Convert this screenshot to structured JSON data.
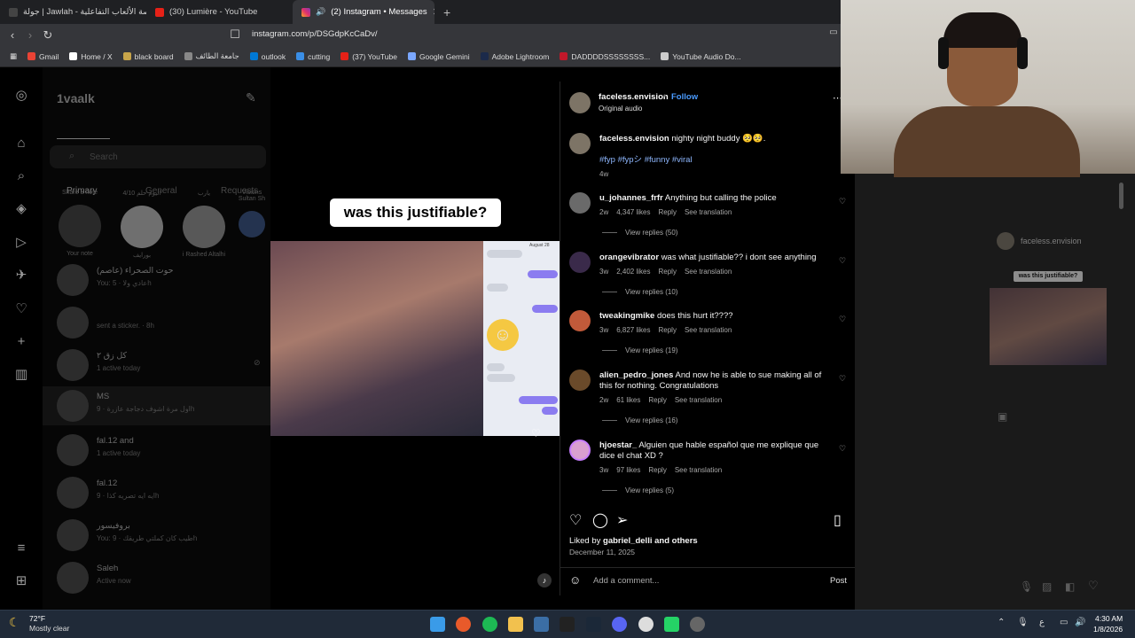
{
  "browser": {
    "tabs": [
      {
        "label": "جولة | Jawlah - منصة الألعاب التفاعلية",
        "active": false
      },
      {
        "label": "(30) Lumière - YouTube",
        "active": false
      },
      {
        "label": "(2) Instagram • Messages",
        "active": true
      }
    ],
    "url": "instagram.com/p/DSGdpKcCaDv/",
    "bookmarks": [
      "Gmail",
      "Home / X",
      "black board",
      "جامعة الطائف",
      "outlook",
      "cutting",
      "(37) YouTube",
      "Google Gemini",
      "Adobe Lightroom",
      "DADDDDSSSSSSSS...",
      "YouTube Audio Do..."
    ]
  },
  "inbox": {
    "username": "1vaalk",
    "tabs": [
      "Primary",
      "General",
      "Requests"
    ],
    "search_placeholder": "Search",
    "notes": [
      {
        "text": "Share a note",
        "name": "Your note"
      },
      {
        "text": "اليوم حلم 4/10",
        "name": "بورايف"
      },
      {
        "text": "يارب",
        "name": "i Rashed Altalhi"
      },
      {
        "text": "Visions Sultan Sh",
        "name": ""
      }
    ],
    "conversations": [
      {
        "name": "حوت الصحراء (عاصم)",
        "sub": "You: عادي ولا · 5h"
      },
      {
        "name": "",
        "sub": "sent a sticker. · 8h"
      },
      {
        "name": "كل زق ٢",
        "sub": "1 active today"
      },
      {
        "name": "MS",
        "sub": "اول مرة اشوف دجاجة عازرة · 9h"
      },
      {
        "name": "fal.12 and",
        "sub": "1 active today"
      },
      {
        "name": "fal.12",
        "sub": "ايه ايه تصريه كذا · 9h"
      },
      {
        "name": "بروفيسور",
        "sub": "You: طيب كان كملتي طريقك · 9h"
      },
      {
        "name": "Saleh",
        "sub": "Active now"
      }
    ]
  },
  "media": {
    "caption": "was this justifiable?",
    "chat_label": "August 28"
  },
  "post": {
    "author": "faceless.envision",
    "follow_label": "Follow",
    "audio": "Original audio",
    "caption_text": "nighty night buddy 🥺🥺.",
    "hashtags": "#fyp #fypシ #funny #viral",
    "caption_age": "4w",
    "reply_label": "Reply",
    "translate_label": "See translation",
    "comments": [
      {
        "user": "u_johannes_frfr",
        "text": "Anything but calling the police",
        "age": "2w",
        "likes": "4,347 likes",
        "replies": "View replies (50)"
      },
      {
        "user": "orangevibrator",
        "text": "was what justifiable?? i dont see anything",
        "age": "3w",
        "likes": "2,402 likes",
        "replies": "View replies (10)"
      },
      {
        "user": "tweakingmike",
        "text": "does this hurt it????",
        "age": "3w",
        "likes": "6,827 likes",
        "replies": "View replies (19)"
      },
      {
        "user": "alien_pedro_jones",
        "text": "And now he is able to sue making all of this for nothing. Congratulations",
        "age": "2w",
        "likes": "61 likes",
        "replies": "View replies (16)"
      },
      {
        "user": "hjoestar_",
        "text": "Alguien que hable español que me explique que dice el chat XD ?",
        "age": "3w",
        "likes": "97 likes",
        "replies": "View replies (5)"
      }
    ],
    "liked_by_prefix": "Liked by",
    "liked_by_user": "gabriel_delli",
    "liked_by_suffix": "and others",
    "date": "December 11, 2025",
    "add_comment_placeholder": "Add a comment...",
    "post_button": "Post"
  },
  "side_preview": {
    "author": "faceless.envision",
    "caption": "was this justifiable?"
  },
  "taskbar": {
    "temp": "72°F",
    "weather": "Mostly clear",
    "time": "4:30 AM",
    "date": "1/8/2026"
  },
  "colors": {
    "follow_blue": "#4a9bff",
    "bg": "#000000",
    "taskbar": "#202a38"
  }
}
